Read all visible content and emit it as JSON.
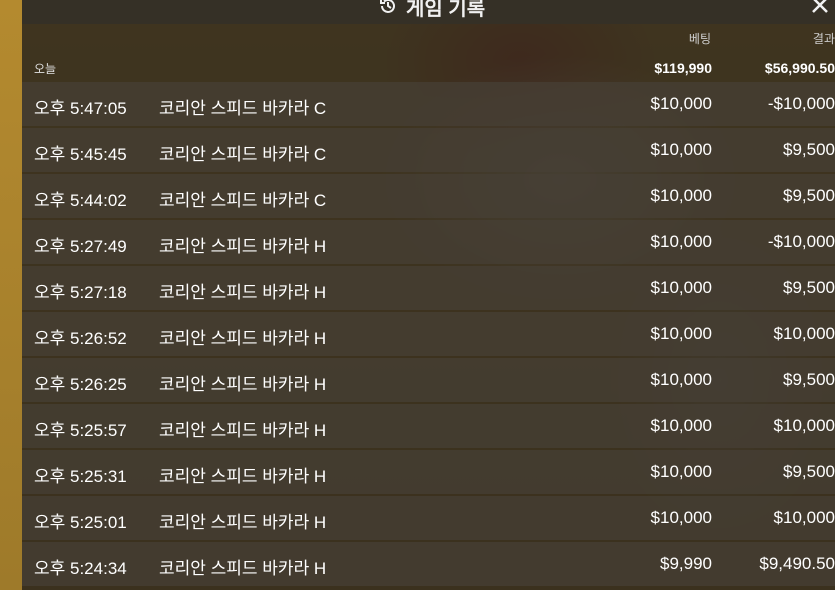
{
  "header": {
    "title": "게임 기록",
    "columns": {
      "bet": "베팅",
      "result": "결과"
    }
  },
  "summary": {
    "label": "오늘",
    "total_bet": "$119,990",
    "total_result": "$56,990.50"
  },
  "rows": [
    {
      "time": "오후 5:47:05",
      "game": "코리안 스피드 바카라 C",
      "bet": "$10,000",
      "result": "-$10,000"
    },
    {
      "time": "오후 5:45:45",
      "game": "코리안 스피드 바카라 C",
      "bet": "$10,000",
      "result": "$9,500"
    },
    {
      "time": "오후 5:44:02",
      "game": "코리안 스피드 바카라 C",
      "bet": "$10,000",
      "result": "$9,500"
    },
    {
      "time": "오후 5:27:49",
      "game": "코리안 스피드 바카라 H",
      "bet": "$10,000",
      "result": "-$10,000"
    },
    {
      "time": "오후 5:27:18",
      "game": "코리안 스피드 바카라 H",
      "bet": "$10,000",
      "result": "$9,500"
    },
    {
      "time": "오후 5:26:52",
      "game": "코리안 스피드 바카라 H",
      "bet": "$10,000",
      "result": "$10,000"
    },
    {
      "time": "오후 5:26:25",
      "game": "코리안 스피드 바카라 H",
      "bet": "$10,000",
      "result": "$9,500"
    },
    {
      "time": "오후 5:25:57",
      "game": "코리안 스피드 바카라 H",
      "bet": "$10,000",
      "result": "$10,000"
    },
    {
      "time": "오후 5:25:31",
      "game": "코리안 스피드 바카라 H",
      "bet": "$10,000",
      "result": "$9,500"
    },
    {
      "time": "오후 5:25:01",
      "game": "코리안 스피드 바카라 H",
      "bet": "$10,000",
      "result": "$10,000"
    },
    {
      "time": "오후 5:24:34",
      "game": "코리안 스피드 바카라 H",
      "bet": "$9,990",
      "result": "$9,490.50"
    }
  ],
  "icons": {
    "title": "history-icon",
    "close": "close-icon"
  },
  "colors": {
    "panel": "#26221c",
    "row": "#464036",
    "text": "#ffffff"
  }
}
